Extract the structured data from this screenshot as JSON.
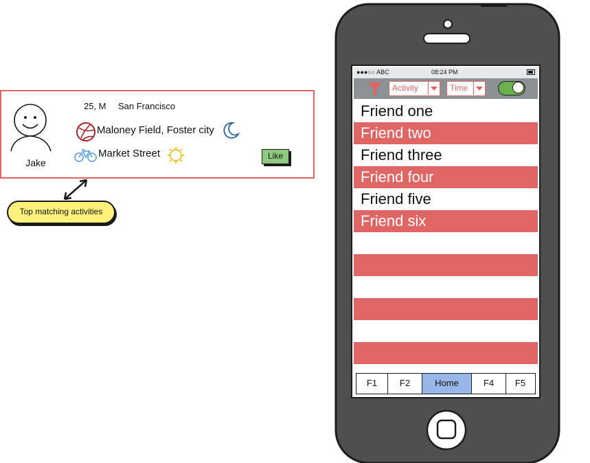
{
  "profile": {
    "name": "Jake",
    "age_gender": "25, M",
    "city": "San Francisco",
    "activities": [
      {
        "label": "Maloney Field, Foster city",
        "icon": "basketball-icon",
        "time_icon": "moon-icon"
      },
      {
        "label": "Market Street",
        "icon": "bicycle-icon",
        "time_icon": "sun-icon"
      }
    ],
    "like_label": "Like"
  },
  "callout": {
    "text": "Top matching activities"
  },
  "phone": {
    "status": {
      "carrier": "●●●○○ ABC",
      "time": "08:24 PM"
    },
    "filters": {
      "activity_label": "Activity",
      "time_label": "Time",
      "toggle_on": true
    },
    "friends": [
      "Friend one",
      "Friend two",
      "Friend three",
      "Friend four",
      "Friend five",
      "Friend six"
    ],
    "tabs": [
      {
        "label": "F1"
      },
      {
        "label": "F2"
      },
      {
        "label": "Home",
        "active": true
      },
      {
        "label": "F4"
      },
      {
        "label": "F5"
      }
    ]
  },
  "colors": {
    "accent_red": "#e06666",
    "like_green": "#8fc97f",
    "toggle_green": "#6ab04c",
    "active_tab_blue": "#98b6e8",
    "callout_yellow": "#fff27a",
    "phone_body": "#4f4f4f"
  }
}
